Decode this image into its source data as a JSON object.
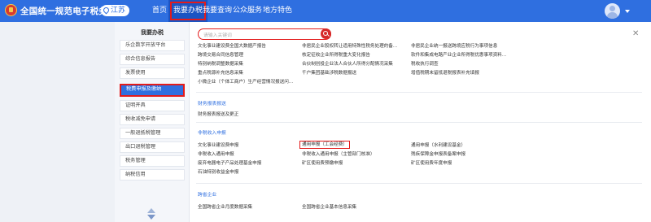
{
  "header": {
    "site_title": "全国统一规范电子税务局",
    "region": "江苏",
    "nav": [
      "首页",
      "我要办税",
      "我要查询",
      "公众服务",
      "地方特色"
    ]
  },
  "sidebar": {
    "title": "我要办税",
    "items": [
      "乐企数字开放平台",
      "综合信息报告",
      "发票使用",
      "税费申报及缴纳",
      "证明开具",
      "税收减免申请",
      "一般退抵税管理",
      "出口退税管理",
      "税务管理",
      "纳税信用"
    ]
  },
  "search": {
    "placeholder": "请输入关键词"
  },
  "quick_links": [
    "文化事业建设费全国大数据产报告",
    "非居民企业股权转让适用特殊性税务处理的备...",
    "非居民企业统一报送跨境应税行为事项信息",
    "跨境交易合同信息管理",
    "核定征收企业所得税重大变化报告",
    "软件和集成电路产业企业所得税优惠事项资料...",
    "特别纳税调整数据采集",
    "合伙制创投企业法人合伙人所得分配情况采集",
    "税收执行调查",
    "重点税源补充信息采集",
    "千户集团基础涉税数据报送",
    "增值税期末留抵退税报表补充填报",
    "小微企业（个体工商户）生产经营情况报送问..."
  ],
  "sections": [
    {
      "title": "财务报表报送",
      "links": [
        "财务报表报送及更正"
      ]
    },
    {
      "title": "非税收入申报",
      "links": [
        "文化事业建设费申报",
        "通用申报（工会经费）",
        "通用申报（水利建设基金）",
        "非税收入通用申报",
        "非税收入通用申报（主管部门核准）",
        "残疾保障金申报表备案申报",
        "废弃电器电子产品处理基金申报",
        "矿区使用费预缴申报",
        "矿区使用费年度申报",
        "石油特别收益金申报"
      ]
    },
    {
      "title": "跨省企业",
      "links": [
        "全国跨省企业月度数据采集",
        "全国跨省企业基本信息采集"
      ]
    }
  ]
}
